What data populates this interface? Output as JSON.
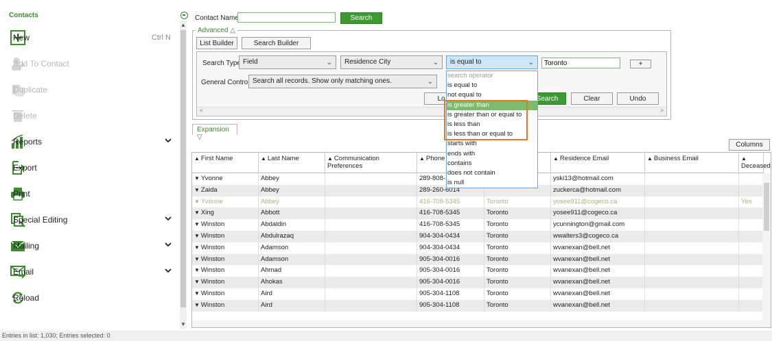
{
  "sidebar": {
    "title": "Contacts",
    "items": [
      {
        "label": "New",
        "shortcut": "Ctrl N",
        "icon": "plus-icon",
        "disabled": false
      },
      {
        "label": "Add To Contact",
        "icon": "add-contact-icon",
        "disabled": true
      },
      {
        "label": "Duplicate",
        "icon": "duplicate-icon",
        "disabled": true
      },
      {
        "label": "Delete",
        "icon": "trash-icon",
        "disabled": true
      },
      {
        "label": "Reports",
        "icon": "bar-chart-icon",
        "disabled": false,
        "expandable": true
      },
      {
        "label": "Export",
        "icon": "export-icon",
        "disabled": false
      },
      {
        "label": "Print",
        "icon": "printer-icon",
        "disabled": false
      },
      {
        "label": "Special Editing",
        "icon": "special-edit-icon",
        "disabled": false,
        "expandable": true
      },
      {
        "label": "Mailing",
        "icon": "mail-icon",
        "disabled": false,
        "expandable": true
      },
      {
        "label": "Email",
        "icon": "email-icon",
        "disabled": false,
        "expandable": true
      },
      {
        "label": "Reload",
        "icon": "reload-icon",
        "disabled": false
      }
    ]
  },
  "search": {
    "contact_name_label": "Contact Name",
    "contact_name_value": "",
    "search_button": "Search",
    "advanced_label": "Advanced △",
    "list_builder": "List Builder",
    "search_builder": "Search Builder",
    "search_type_label": "Search Type:",
    "search_type_value": "Field",
    "field_value": "Residence City",
    "operator_value": "is equal to",
    "criteria_value": "Toronto",
    "add_button": "+",
    "general_control_label": "General Control:",
    "general_control_value": "Search all records. Show only matching ones.",
    "load_button": "Lo",
    "search2_button": "Search",
    "clear_button": "Clear",
    "undo_button": "Undo",
    "expansion_label": "Expansion ▽",
    "columns_button": "Columns"
  },
  "operator_options": [
    "search operator",
    "is equal to",
    "not equal to",
    "is greater than",
    "is greater than or equal to",
    "is less than",
    "is less than or equal to",
    "starts with",
    "ends with",
    "contains",
    "does not contain",
    "is null"
  ],
  "selected_operator_index": 3,
  "table": {
    "columns": [
      "First Name",
      "Last Name",
      "Communication Preferences",
      "Phone",
      "",
      "Residence Email",
      "Business Email",
      "Deceased"
    ],
    "rows": [
      {
        "first": "Yvonne",
        "last": "Abbey",
        "phone": "289-808-1",
        "city": "",
        "email": "yski13@hotmail.com",
        "dec": ""
      },
      {
        "first": "Zaida",
        "last": "Abbey",
        "phone": "289-260-6014",
        "city": "",
        "email": "zuckerca@hotmail.com",
        "dec": ""
      },
      {
        "first": "Yvonne",
        "last": "Abbey",
        "phone": "416-708-5345",
        "city": "Toronto",
        "email": "yosee911@cogeco.ca",
        "dec": "Yes"
      },
      {
        "first": "Xing",
        "last": "Abbott",
        "phone": "416-708-5345",
        "city": "Toronto",
        "email": "yosee911@cogeco.ca",
        "dec": ""
      },
      {
        "first": "Winston",
        "last": "Abdaldin",
        "phone": "416-708-5345",
        "city": "Toronto",
        "email": "ycunnington@gmail.com",
        "dec": ""
      },
      {
        "first": "Winston",
        "last": "Abdulrazaq",
        "phone": "904-304-0434",
        "city": "Toronto",
        "email": "wwalters3@cogeco.ca",
        "dec": ""
      },
      {
        "first": "Winston",
        "last": "Adamson",
        "phone": "904-304-0434",
        "city": "Toronto",
        "email": "wvanexan@bell.net",
        "dec": ""
      },
      {
        "first": "Winston",
        "last": "Adamson",
        "phone": "905-304-0016",
        "city": "Toronto",
        "email": "wvanexan@bell.net",
        "dec": ""
      },
      {
        "first": "Winston",
        "last": "Ahmad",
        "phone": "905-304-0016",
        "city": "Toronto",
        "email": "wvanexan@bell.net",
        "dec": ""
      },
      {
        "first": "Winston",
        "last": "Ahokas",
        "phone": "905-304-0016",
        "city": "Toronto",
        "email": "wvanexan@bell.net",
        "dec": ""
      },
      {
        "first": "Winston",
        "last": "Aird",
        "phone": "905-304-1108",
        "city": "Toronto",
        "email": "wvanexan@bell.net",
        "dec": ""
      },
      {
        "first": "Winston",
        "last": "Aird",
        "phone": "905-304-1108",
        "city": "Toronto",
        "email": "wvanexan@bell.net",
        "dec": ""
      }
    ]
  },
  "status": "Entries in list: 1,030; Entries selected: 0",
  "colors": {
    "accent": "#3d9a33",
    "highlight": "#e07a2a"
  }
}
